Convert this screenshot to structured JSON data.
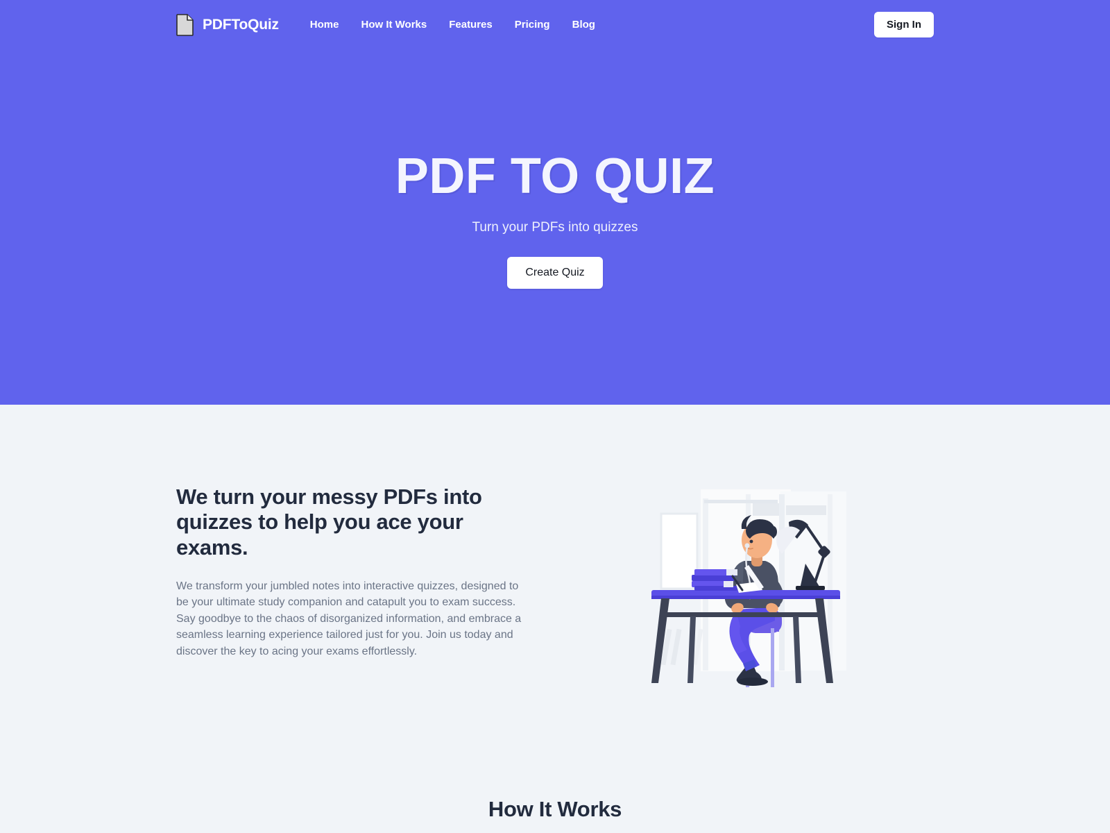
{
  "brand": {
    "name": "PDFToQuiz",
    "logo_icon": "document-page-icon"
  },
  "nav": {
    "links": [
      {
        "label": "Home"
      },
      {
        "label": "How It Works"
      },
      {
        "label": "Features"
      },
      {
        "label": "Pricing"
      },
      {
        "label": "Blog"
      }
    ],
    "signin_label": "Sign In"
  },
  "hero": {
    "title": "PDF TO QUIZ",
    "subtitle": "Turn your PDFs into quizzes",
    "cta_label": "Create Quiz",
    "background_color": "#6063ed",
    "title_color": "#f4f5fe"
  },
  "about": {
    "heading": "We turn your messy PDFs into quizzes to help you ace your exams.",
    "body": "We transform your jumbled notes into interactive quizzes, designed to be your ultimate study companion and catapult you to exam success. Say goodbye to the chaos of disorganized information, and embrace a seamless learning experience tailored just for you. Join us today and discover the key to acing your exams effortlessly.",
    "illustration": "student-studying-at-desk-illustration",
    "background_color": "#f1f4f8",
    "heading_color": "#222b3e",
    "body_color": "#6a7486"
  },
  "how_it_works": {
    "heading": "How It Works"
  }
}
